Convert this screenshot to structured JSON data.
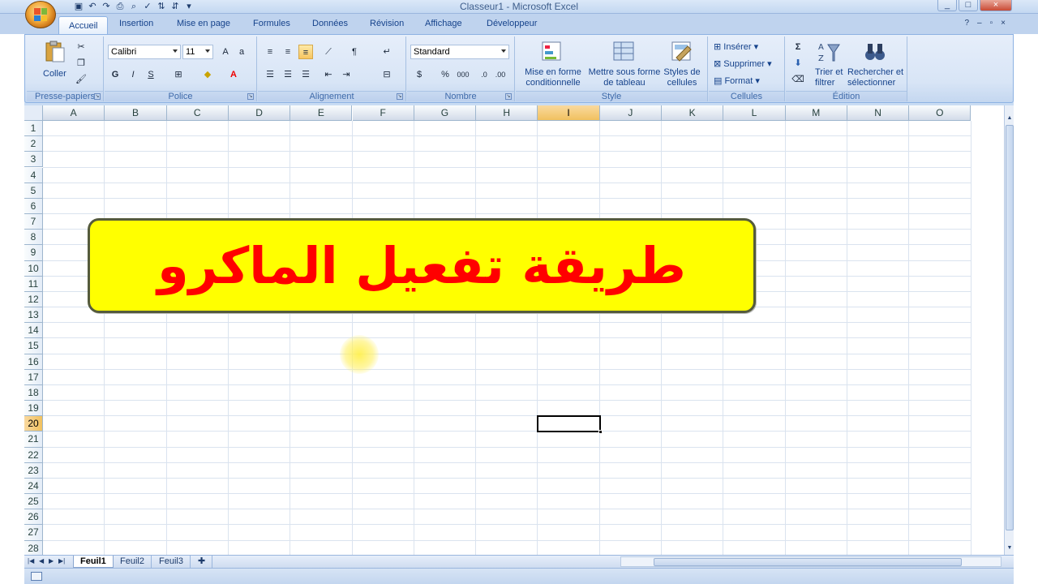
{
  "window": {
    "title": "Classeur1 - Microsoft Excel",
    "controls": [
      "_",
      "□",
      "×"
    ]
  },
  "tabs": [
    "Accueil",
    "Insertion",
    "Mise en page",
    "Formules",
    "Données",
    "Révision",
    "Affichage",
    "Développeur"
  ],
  "ribbon": {
    "clipboard": {
      "paste": "Coller",
      "label": "Presse-papiers"
    },
    "font": {
      "name": "Calibri",
      "size": "11",
      "bold": "G",
      "italic": "I",
      "underline": "S",
      "label": "Police"
    },
    "alignment": {
      "label": "Alignement"
    },
    "number": {
      "format": "Standard",
      "percent": "%",
      "thousands": "000",
      "label": "Nombre"
    },
    "style": {
      "conditional": [
        "Mise en forme",
        "conditionnelle"
      ],
      "table": [
        "Mettre sous forme",
        "de tableau"
      ],
      "cell_styles": [
        "Styles de",
        "cellules"
      ],
      "label": "Style"
    },
    "cells": {
      "insert": "Insérer",
      "delete": "Supprimer",
      "format": "Format",
      "label": "Cellules"
    },
    "editing": {
      "sort": [
        "Trier et",
        "filtrer"
      ],
      "find": [
        "Rechercher et",
        "sélectionner"
      ],
      "label": "Édition"
    }
  },
  "grid": {
    "columns": [
      "A",
      "B",
      "C",
      "D",
      "E",
      "F",
      "G",
      "H",
      "I",
      "J",
      "K",
      "L",
      "M",
      "N",
      "O"
    ],
    "rows": [
      "1",
      "2",
      "3",
      "4",
      "5",
      "6",
      "7",
      "8",
      "9",
      "10",
      "11",
      "12",
      "13",
      "14",
      "15",
      "16",
      "17",
      "18",
      "19",
      "20",
      "21",
      "22",
      "23",
      "24",
      "25",
      "26",
      "27",
      "28"
    ],
    "selected_column": "I",
    "selected_row": "20"
  },
  "banner": {
    "text": "طريقة تفعيل الماكرو",
    "background": "#ffff00",
    "color": "#ff0000"
  },
  "sheets": [
    "Feuil1",
    "Feuil2",
    "Feuil3"
  ],
  "active_sheet": "Feuil1"
}
